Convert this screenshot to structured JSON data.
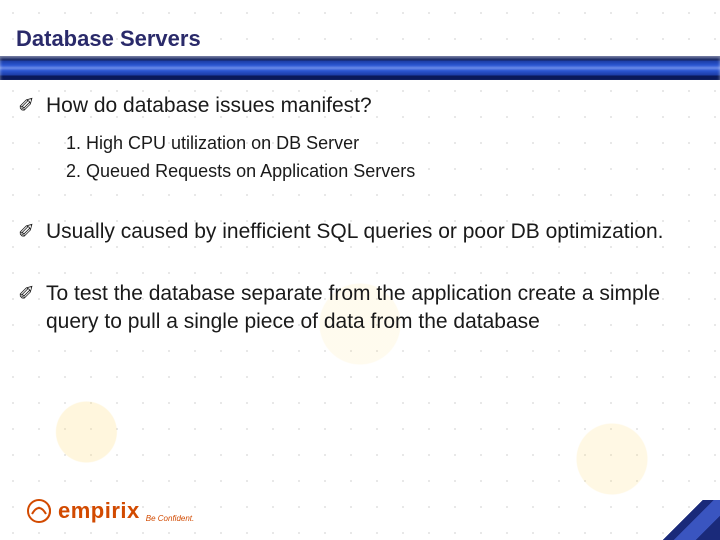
{
  "title": "Database Servers",
  "bullet_glyph": "✐",
  "bullets": [
    {
      "text": "How do database issues manifest?",
      "sub": [
        "1.  High CPU utilization on DB Server",
        "2.  Queued Requests on Application Servers"
      ]
    },
    {
      "text": "Usually caused by inefficient SQL queries or poor DB optimization.",
      "sub": []
    },
    {
      "text": "To test the database separate from the application create a simple query to pull a single piece of data from the database",
      "sub": []
    }
  ],
  "logo": {
    "word": "empirix",
    "tag": "Be Confident."
  }
}
